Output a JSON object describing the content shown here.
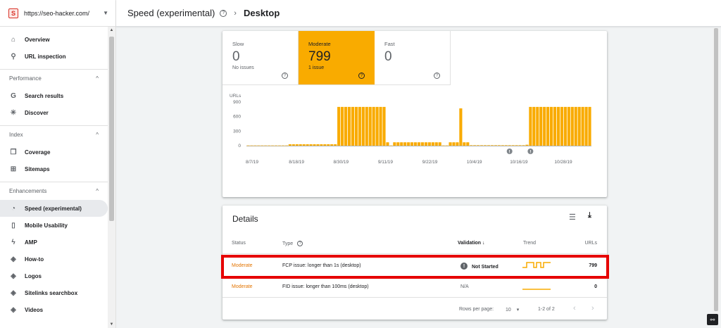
{
  "property": {
    "url": "https://seo-hacker.com/"
  },
  "sidebar": {
    "top_items": [
      {
        "label": "Overview",
        "icon": "home-icon"
      },
      {
        "label": "URL inspection",
        "icon": "search-icon"
      }
    ],
    "sections": [
      {
        "title": "Performance",
        "items": [
          {
            "label": "Search results",
            "icon": "google-g-icon"
          },
          {
            "label": "Discover",
            "icon": "asterisk-icon"
          }
        ]
      },
      {
        "title": "Index",
        "items": [
          {
            "label": "Coverage",
            "icon": "copy-icon"
          },
          {
            "label": "Sitemaps",
            "icon": "sitemap-icon"
          }
        ]
      },
      {
        "title": "Enhancements",
        "items": [
          {
            "label": "Speed (experimental)",
            "icon": "speedometer-icon",
            "active": true
          },
          {
            "label": "Mobile Usability",
            "icon": "phone-icon"
          },
          {
            "label": "AMP",
            "icon": "bolt-icon"
          },
          {
            "label": "How-to",
            "icon": "layers-icon"
          },
          {
            "label": "Logos",
            "icon": "layers-icon"
          },
          {
            "label": "Sitelinks searchbox",
            "icon": "layers-icon"
          },
          {
            "label": "Videos",
            "icon": "layers-icon"
          }
        ]
      }
    ]
  },
  "header": {
    "title": "Speed (experimental)",
    "subtitle": "Desktop"
  },
  "tiles": [
    {
      "label": "Slow",
      "value": "0",
      "sub": "No issues",
      "selected": false
    },
    {
      "label": "Moderate",
      "value": "799",
      "sub": "1 issue",
      "selected": true
    },
    {
      "label": "Fast",
      "value": "0",
      "sub": "",
      "selected": false
    }
  ],
  "colors": {
    "accent": "#f9ab00",
    "status_moderate": "#e37400",
    "highlight": "#e60000"
  },
  "chart_data": {
    "type": "bar",
    "ylabel": "URLs",
    "ylim": [
      0,
      900
    ],
    "yticks": [
      0,
      300,
      600,
      900
    ],
    "xtick_labels": [
      "8/7/19",
      "8/18/19",
      "8/30/19",
      "9/11/19",
      "9/22/19",
      "10/4/19",
      "10/16/19",
      "10/28/19"
    ],
    "values": [
      5,
      5,
      5,
      5,
      5,
      5,
      5,
      5,
      5,
      5,
      5,
      5,
      30,
      30,
      30,
      30,
      30,
      30,
      30,
      30,
      30,
      30,
      30,
      30,
      30,
      30,
      800,
      800,
      800,
      800,
      800,
      800,
      800,
      800,
      800,
      800,
      800,
      800,
      800,
      800,
      70,
      5,
      70,
      70,
      70,
      70,
      70,
      70,
      70,
      70,
      70,
      70,
      70,
      70,
      70,
      70,
      5,
      5,
      70,
      70,
      70,
      770,
      70,
      70,
      10,
      10,
      10,
      10,
      10,
      10,
      10,
      10,
      10,
      10,
      10,
      10,
      10,
      10,
      10,
      10,
      20,
      800,
      800,
      800,
      800,
      800,
      800,
      800,
      800,
      800,
      800,
      800,
      800,
      800,
      800,
      800,
      800,
      800,
      800
    ],
    "annotation_positions": [
      75,
      81
    ],
    "series": [
      {
        "values_ref": "values",
        "color": "#f9ab00"
      }
    ]
  },
  "details": {
    "title": "Details",
    "columns": {
      "status": "Status",
      "type": "Type",
      "validation": "Validation",
      "trend": "Trend",
      "urls": "URLs"
    },
    "rows": [
      {
        "status": "Moderate",
        "type": "FCP issue: longer than 1s (desktop)",
        "validation": "Not Started",
        "urls": "799",
        "trend": "stepped"
      },
      {
        "status": "Moderate",
        "type": "FID issue: longer than 100ms (desktop)",
        "validation": "N/A",
        "urls": "0",
        "trend": "flat"
      }
    ],
    "pager": {
      "rows_label": "Rows per page:",
      "rows_value": "10",
      "range": "1-2 of 2"
    }
  }
}
